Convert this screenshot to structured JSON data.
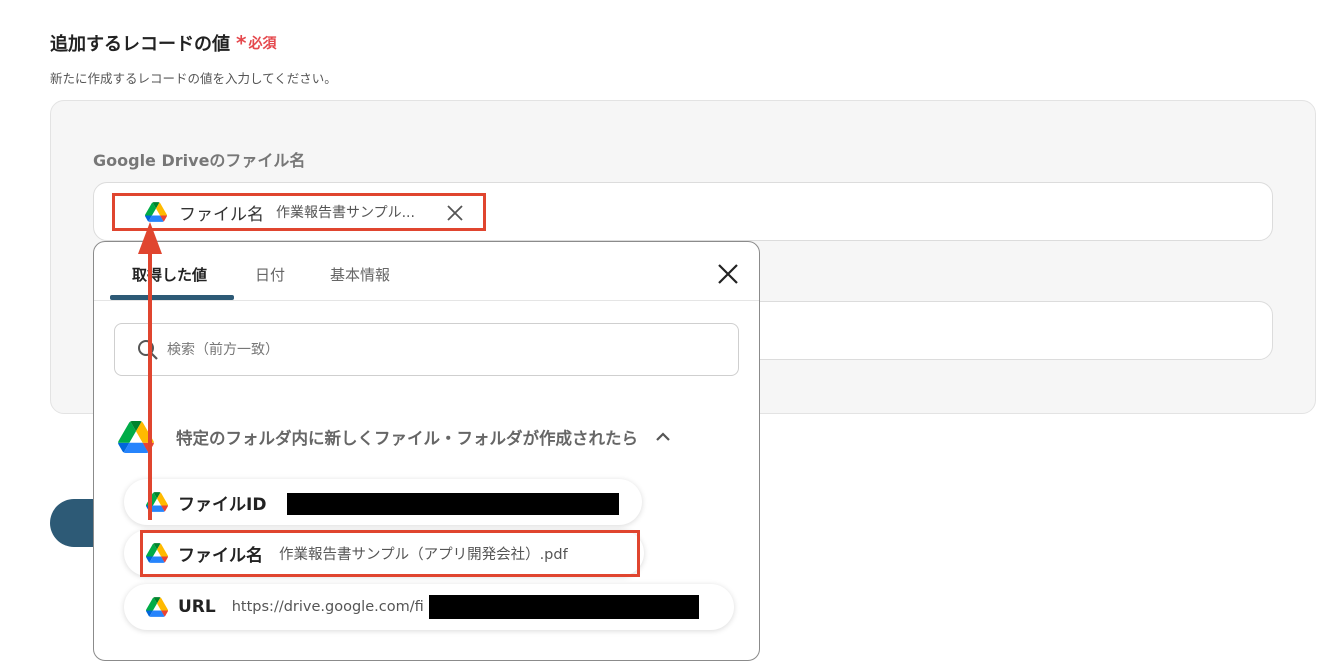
{
  "section": {
    "title": "追加するレコードの値",
    "required_mark": "*",
    "required_label": "必須",
    "description": "新たに作成するレコードの値を入力してください。"
  },
  "field": {
    "label": "Google Driveのファイル名",
    "chip_label": "ファイル名",
    "chip_value": "作業報告書サンプル..."
  },
  "popup": {
    "tabs": [
      "取得した値",
      "日付",
      "基本情報"
    ],
    "active_tab": "取得した値",
    "search_placeholder": "検索（前方一致）",
    "group_title": "特定のフォルダ内に新しくファイル・フォルダが作成されたら",
    "items": [
      {
        "label": "ファイルID",
        "value": ""
      },
      {
        "label": "ファイル名",
        "value": "作業報告書サンプル（アプリ開発会社）.pdf"
      },
      {
        "label": "URL",
        "value": "https://drive.google.com/fi"
      }
    ]
  },
  "colors": {
    "accent": "#2d5a76",
    "highlight": "#e0452f",
    "required": "#e5484d"
  },
  "icons": [
    "google-drive-icon",
    "close-icon",
    "search-icon",
    "chevron-up-icon"
  ]
}
